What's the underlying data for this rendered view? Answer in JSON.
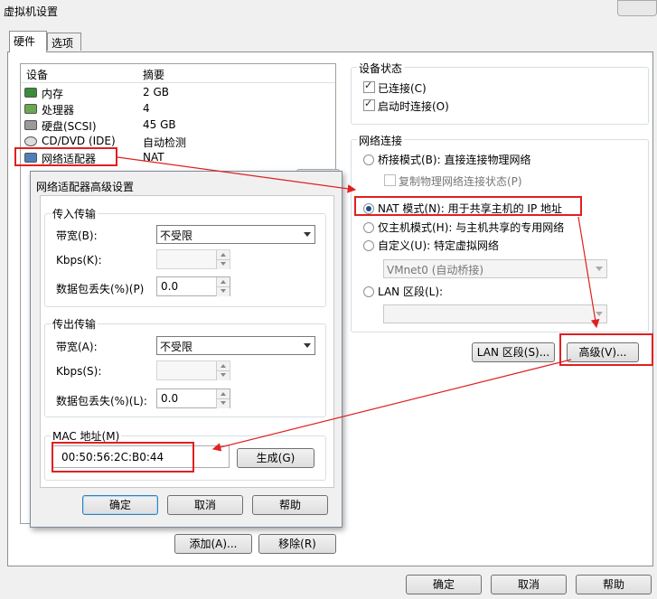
{
  "window": {
    "title": "虚拟机设置"
  },
  "tabs": [
    {
      "label": "硬件"
    },
    {
      "label": "选项"
    }
  ],
  "device_list": {
    "headers": {
      "device": "设备",
      "summary": "摘要"
    },
    "rows": [
      {
        "name": "内存",
        "summary": "2 GB",
        "icon": "memory-icon"
      },
      {
        "name": "处理器",
        "summary": "4",
        "icon": "processor-icon"
      },
      {
        "name": "硬盘(SCSI)",
        "summary": "45 GB",
        "icon": "hard-disk-icon"
      },
      {
        "name": "CD/DVD (IDE)",
        "summary": "自动检测",
        "icon": "cd-dvd-icon"
      },
      {
        "name": "网络适配器",
        "summary": "NAT",
        "icon": "network-adapter-icon"
      }
    ],
    "add_button": "添加(A)...",
    "remove_button": "移除(R)"
  },
  "device_status": {
    "title": "设备状态",
    "connected": "已连接(C)",
    "connect_on_power": "启动时连接(O)"
  },
  "network_connection": {
    "title": "网络连接",
    "bridged": "桥接模式(B): 直接连接物理网络",
    "replicate": "复制物理网络连接状态(P)",
    "nat": "NAT 模式(N): 用于共享主机的 IP 地址",
    "host_only": "仅主机模式(H): 与主机共享的专用网络",
    "custom": "自定义(U): 特定虚拟网络",
    "custom_value": "VMnet0 (自动桥接)",
    "lan_segment": "LAN 区段(L):",
    "lan_segments_button": "LAN 区段(S)...",
    "advanced_button": "高级(V)..."
  },
  "footer": {
    "ok": "确定",
    "cancel": "取消",
    "help": "帮助"
  },
  "advanced_dialog": {
    "title": "网络适配器高级设置",
    "incoming": {
      "title": "传入传输",
      "bandwidth_label": "带宽(B):",
      "bandwidth_value": "不受限",
      "kbps_label": "Kbps(K):",
      "loss_label": "数据包丢失(%)(P)",
      "loss_value": "0.0"
    },
    "outgoing": {
      "title": "传出传输",
      "bandwidth_label": "带宽(A):",
      "bandwidth_value": "不受限",
      "kbps_label": "Kbps(S):",
      "loss_label": "数据包丢失(%)(L):",
      "loss_value": "0.0"
    },
    "mac": {
      "title": "MAC 地址(M)",
      "value": "00:50:56:2C:B0:44",
      "generate": "生成(G)"
    },
    "ok": "确定",
    "cancel": "取消",
    "help": "帮助"
  },
  "colors": {
    "annotation": "#e02020",
    "selection": "#cce4f7"
  }
}
